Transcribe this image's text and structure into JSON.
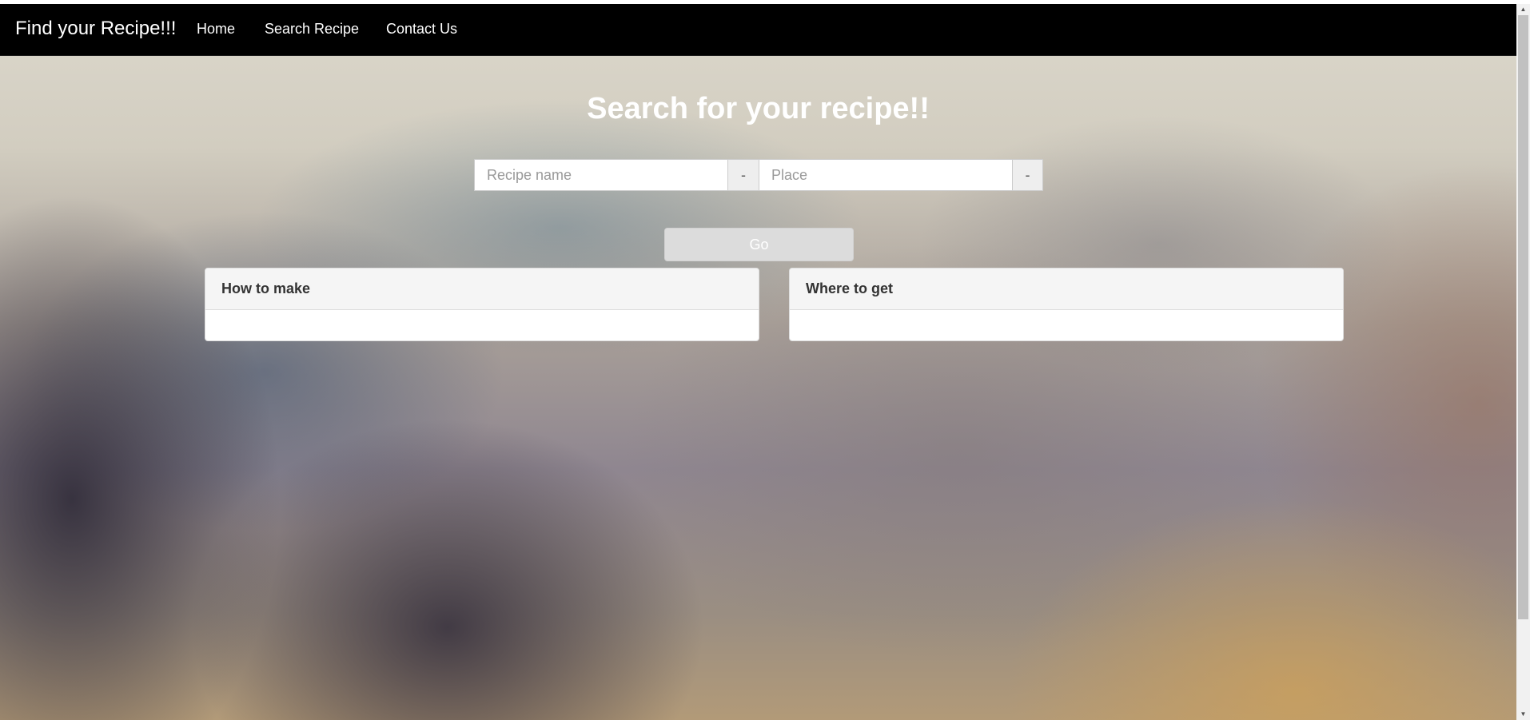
{
  "navbar": {
    "brand": "Find your Recipe!!!",
    "links": [
      {
        "label": "Home"
      },
      {
        "label": "Search Recipe"
      },
      {
        "label": "Contact Us"
      }
    ]
  },
  "main": {
    "title": "Search for your recipe!!",
    "search": {
      "recipe_placeholder": "Recipe name",
      "recipe_value": "",
      "recipe_addon": "-",
      "place_placeholder": "Place",
      "place_value": "",
      "place_addon": "-"
    },
    "go_label": "Go"
  },
  "panels": [
    {
      "heading": "How to make",
      "body": ""
    },
    {
      "heading": "Where to get",
      "body": ""
    }
  ],
  "colors": {
    "navbar_bg": "#000000",
    "navbar_text": "#ffffff",
    "title_text": "#ffffff",
    "button_bg": "#dcdcdc",
    "panel_heading_bg": "#f5f5f5"
  },
  "icons": {
    "scroll_up": "triangle-up-icon",
    "scroll_down": "triangle-down-icon"
  }
}
